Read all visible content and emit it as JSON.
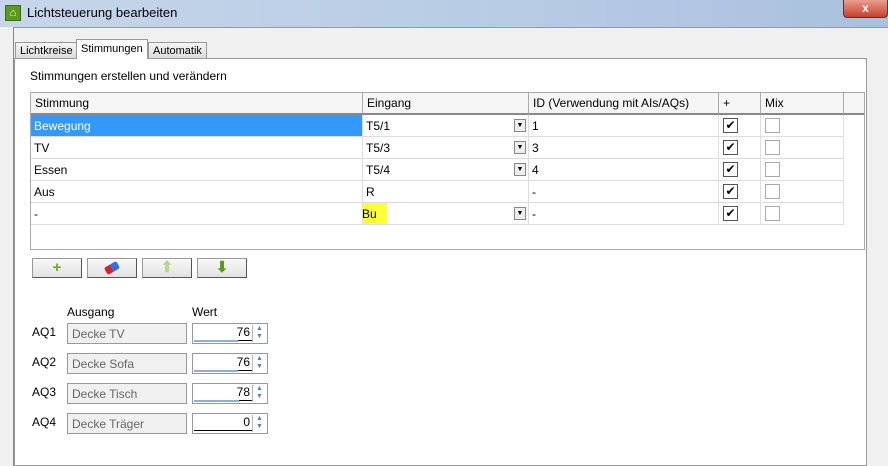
{
  "window": {
    "title": "Lichtsteuerung bearbeiten",
    "close_label": "x"
  },
  "tabs": [
    {
      "label": "Lichtkreise"
    },
    {
      "label": "Stimmungen"
    },
    {
      "label": "Automatik"
    }
  ],
  "section_title": "Stimmungen erstellen und verändern",
  "table": {
    "headers": [
      "Stimmung",
      "Eingang",
      "ID (Verwendung mit AIs/AQs)",
      "+",
      "Mix"
    ],
    "rows": [
      {
        "stimmung": "Bewegung",
        "eingang": "T5/1",
        "id": "1",
        "plus": true,
        "mix": false,
        "selected": true,
        "dropdown": true
      },
      {
        "stimmung": "TV",
        "eingang": "T5/3",
        "id": "3",
        "plus": true,
        "mix": false,
        "dropdown": true
      },
      {
        "stimmung": "Essen",
        "eingang": "T5/4",
        "id": "4",
        "plus": true,
        "mix": false,
        "dropdown": true
      },
      {
        "stimmung": "Aus",
        "eingang": "R",
        "id": "-",
        "plus": true,
        "mix": false,
        "dropdown": false
      },
      {
        "stimmung": "-",
        "eingang": "Bu",
        "id": "-",
        "plus": true,
        "mix": false,
        "dropdown": true,
        "highlighted": true
      }
    ]
  },
  "buttons": {
    "add": "+",
    "erase": "eraser",
    "up": "up",
    "down": "down"
  },
  "outputs": {
    "header_ausgang": "Ausgang",
    "header_wert": "Wert",
    "rows": [
      {
        "label": "AQ1",
        "name": "Decke TV",
        "value": "76",
        "percent": 76
      },
      {
        "label": "AQ2",
        "name": "Decke Sofa",
        "value": "76",
        "percent": 76
      },
      {
        "label": "AQ3",
        "name": "Decke Tisch",
        "value": "78",
        "percent": 78
      },
      {
        "label": "AQ4",
        "name": "Decke Träger",
        "value": "0",
        "percent": 0
      }
    ]
  },
  "colors": {
    "selection": "#3399ff",
    "highlight": "#ffff33",
    "accent_green": "#6aaa1e"
  }
}
